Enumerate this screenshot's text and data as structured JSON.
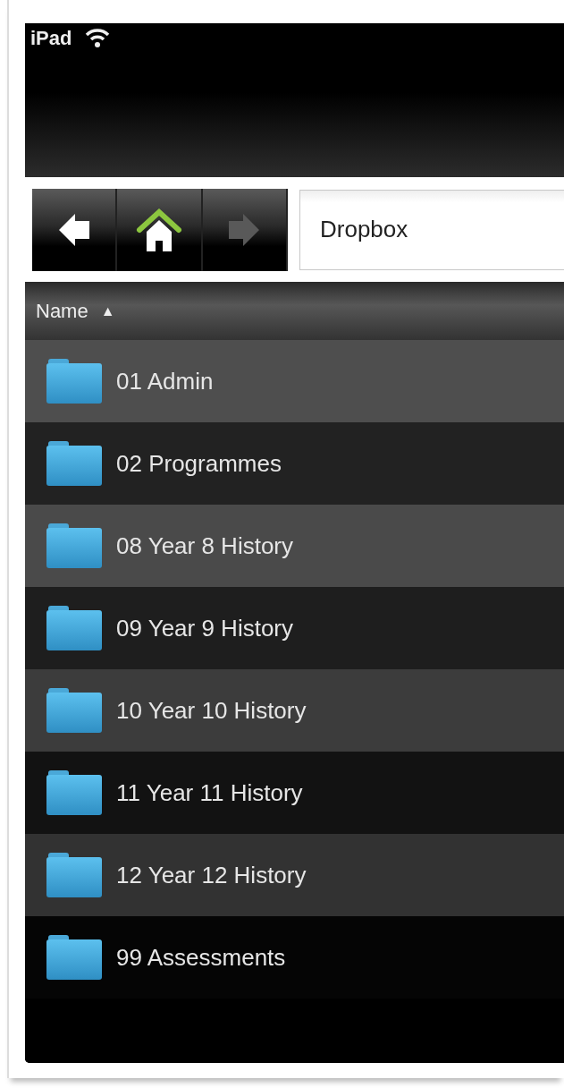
{
  "status_bar": {
    "device": "iPad"
  },
  "toolbar": {
    "nav_buttons": [
      {
        "kind": "back",
        "disabled": false
      },
      {
        "kind": "home",
        "disabled": false
      },
      {
        "kind": "forward",
        "disabled": true
      }
    ],
    "path": "Dropbox"
  },
  "list_header": {
    "column": "Name",
    "sort_indicator": "▲"
  },
  "files": [
    {
      "name": "01 Admin"
    },
    {
      "name": "02 Programmes"
    },
    {
      "name": "08 Year 8 History"
    },
    {
      "name": "09 Year 9 History"
    },
    {
      "name": "10 Year 10 History"
    },
    {
      "name": "11 Year 11 History"
    },
    {
      "name": "12 Year 12 History"
    },
    {
      "name": "99 Assessments"
    }
  ]
}
